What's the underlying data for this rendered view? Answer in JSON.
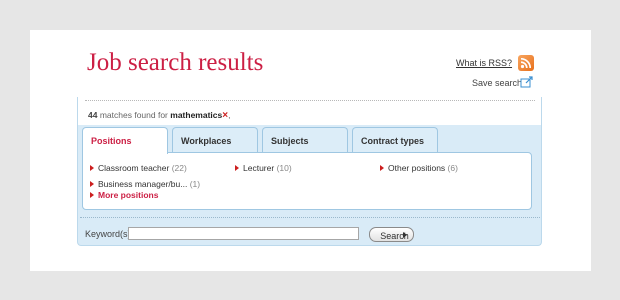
{
  "page": {
    "title": "Job search results",
    "rss_link": "What is RSS?",
    "save_search": "Save search"
  },
  "results": {
    "count": "44",
    "text": "matches found for",
    "term": "mathematics",
    "remove_glyph": "×",
    "trailing": ","
  },
  "tabs": [
    {
      "label": "Positions",
      "active": true
    },
    {
      "label": "Workplaces",
      "active": false
    },
    {
      "label": "Subjects",
      "active": false
    },
    {
      "label": "Contract types",
      "active": false
    }
  ],
  "categories": [
    {
      "label": "Classroom teacher",
      "count": "(22)"
    },
    {
      "label": "Lecturer",
      "count": "(10)"
    },
    {
      "label": "Other positions",
      "count": "(6)"
    },
    {
      "label": "Business manager/bu...",
      "count": "(1)"
    }
  ],
  "more_positions": "More positions",
  "keyword": {
    "label": "Keyword(s)",
    "value": ""
  },
  "search_button": "Search",
  "colors": {
    "title_red": "#cc1f44",
    "panel_blue": "#d9ebf7",
    "tab_border": "#9fc7e2",
    "rss_orange": "#e8701c"
  },
  "icons": {
    "rss": "rss-feed-icon",
    "save": "save-search-icon",
    "remove": "remove-term-icon",
    "bullet": "red-arrow-bullet-icon",
    "button_arrow": "play-arrow-icon"
  }
}
